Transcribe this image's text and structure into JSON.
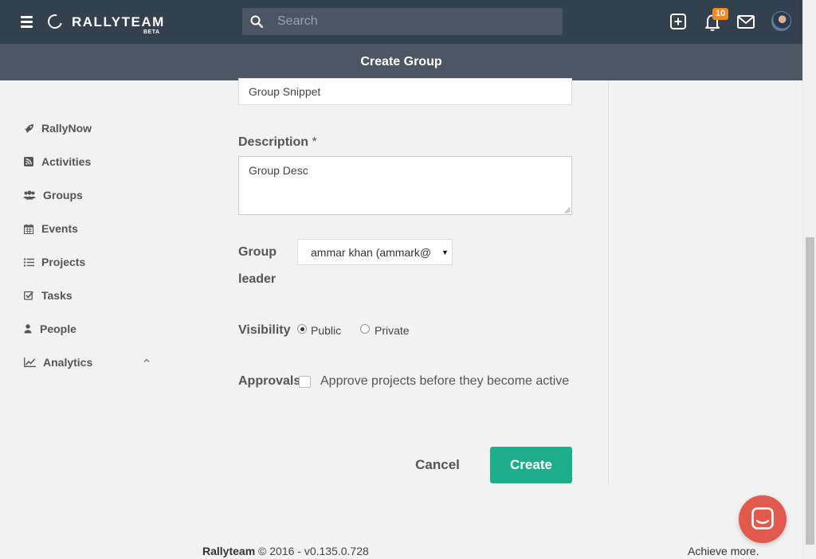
{
  "app": {
    "logo_text": "RALLYTEAM",
    "logo_beta": "BETA"
  },
  "search": {
    "placeholder": "Search"
  },
  "header": {
    "notification_count": "10",
    "page_title": "Create Group"
  },
  "sidebar": {
    "items": [
      {
        "label": "RallyNow",
        "icon": "rocket-icon"
      },
      {
        "label": "Activities",
        "icon": "rss-icon"
      },
      {
        "label": "Groups",
        "icon": "users-icon"
      },
      {
        "label": "Events",
        "icon": "calendar-icon"
      },
      {
        "label": "Projects",
        "icon": "list-icon"
      },
      {
        "label": "Tasks",
        "icon": "check-square-icon"
      },
      {
        "label": "People",
        "icon": "user-icon"
      },
      {
        "label": "Analytics",
        "icon": "line-chart-icon"
      }
    ]
  },
  "form": {
    "snippet_value": "Group Snippet",
    "description_label": "Description",
    "required_marker": "*",
    "description_value": "Group Desc",
    "group_leader_label_1": "Group",
    "group_leader_label_2": "leader",
    "group_leader_value": "ammar khan (ammark@",
    "visibility_label": "Visibility",
    "visibility_options": [
      {
        "label": "Public",
        "selected": true
      },
      {
        "label": "Private",
        "selected": false
      }
    ],
    "approvals_label": "Approvals",
    "approvals_checkbox_label": "Approve projects before they become active",
    "approvals_checked": false,
    "cancel_label": "Cancel",
    "create_label": "Create"
  },
  "footer": {
    "brand": "Rallyteam",
    "copyright": " © 2016 - v0.135.0.728",
    "tagline": "Achieve more."
  },
  "colors": {
    "topbar": "#33404d",
    "subbar": "#4b5763",
    "primary_button": "#1fae8b",
    "badge": "#f08a24",
    "chat_button": "#e05a4e"
  }
}
